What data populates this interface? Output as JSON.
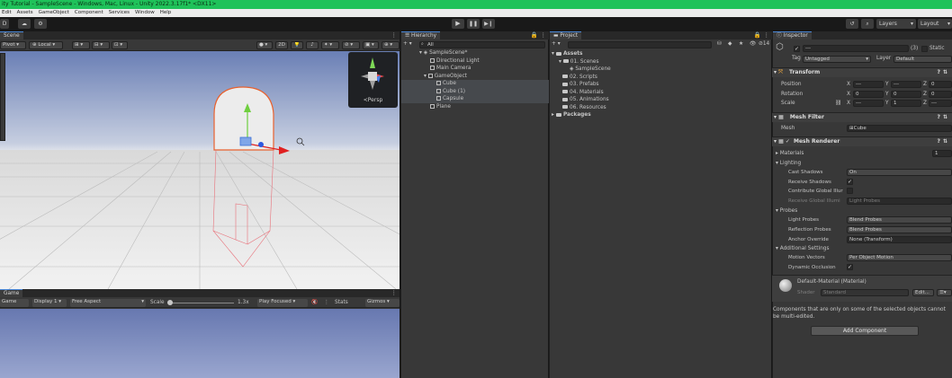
{
  "title_bar": {
    "text": "ity Tutorial - SampleScene - Windows, Mac, Linux - Unity 2022.3.17f1* <DX11>"
  },
  "menu": [
    "Edit",
    "Assets",
    "GameObject",
    "Component",
    "Services",
    "Window",
    "Help"
  ],
  "toolbar": {
    "left_label": "D",
    "layers_label": "Layers",
    "layout_label": "Layout"
  },
  "scene": {
    "tab_label": "Scene",
    "pivot_label": "Pivot",
    "local_label": "Local",
    "mode_2d": "2D",
    "gizmo_label": "<Persp"
  },
  "game": {
    "tab_label": "Game",
    "display_label": "Display 1",
    "aspect_label": "Free Aspect",
    "scale_label": "Scale",
    "scale_value": "1.3x",
    "play_focused_label": "Play Focused",
    "stats_label": "Stats",
    "gizmos_label": "Gizmos"
  },
  "hierarchy": {
    "tab_label": "Hierarchy",
    "search_placeholder": "All",
    "items": [
      {
        "label": "SampleScene*",
        "depth": 0
      },
      {
        "label": "Directional Light",
        "depth": 1
      },
      {
        "label": "Main Camera",
        "depth": 1
      },
      {
        "label": "GameObject",
        "depth": 1
      },
      {
        "label": "Cube",
        "depth": 2
      },
      {
        "label": "Cube (1)",
        "depth": 2
      },
      {
        "label": "Capsule",
        "depth": 2
      },
      {
        "label": "Plane",
        "depth": 1
      }
    ]
  },
  "project": {
    "tab_label": "Project",
    "item_count": "14",
    "items": [
      {
        "label": "Assets",
        "depth": 0,
        "bold": true
      },
      {
        "label": "01. Scenes",
        "depth": 1
      },
      {
        "label": "SampleScene",
        "depth": 2
      },
      {
        "label": "02. Scripts",
        "depth": 1
      },
      {
        "label": "03. Prefabs",
        "depth": 1
      },
      {
        "label": "04. Materials",
        "depth": 1
      },
      {
        "label": "05. Animations",
        "depth": 1
      },
      {
        "label": "06. Resources",
        "depth": 1
      },
      {
        "label": "Packages",
        "depth": 0,
        "bold": true
      }
    ]
  },
  "inspector": {
    "tab_label": "Inspector",
    "name_value": "---",
    "count_badge": "(3)",
    "static_label": "Static",
    "tag_label": "Tag",
    "tag_value": "Untagged",
    "layer_label": "Layer",
    "layer_value": "Default",
    "transform": {
      "title": "Transform",
      "rows": [
        {
          "label": "Position",
          "x": "---",
          "y": "---",
          "z": "0"
        },
        {
          "label": "Rotation",
          "x": "0",
          "y": "0",
          "z": "0"
        },
        {
          "label": "Scale",
          "x": "---",
          "y": "1",
          "z": "---"
        }
      ]
    },
    "mesh_filter": {
      "title": "Mesh Filter",
      "mesh_label": "Mesh",
      "mesh_value": "Cube"
    },
    "mesh_renderer": {
      "title": "Mesh Renderer",
      "materials_label": "Materials",
      "materials_count": "1",
      "lighting_label": "Lighting",
      "cast_shadows_label": "Cast Shadows",
      "cast_shadows_value": "On",
      "receive_shadows_label": "Receive Shadows",
      "contribute_gi_label": "Contribute Global Illur",
      "receive_gi_label": "Receive Global Illumi",
      "receive_gi_value": "Light Probes",
      "probes_label": "Probes",
      "light_probes_label": "Light Probes",
      "light_probes_value": "Blend Probes",
      "reflection_probes_label": "Reflection Probes",
      "reflection_probes_value": "Blend Probes",
      "anchor_override_label": "Anchor Override",
      "anchor_override_value": "None (Transform)",
      "additional_label": "Additional Settings",
      "motion_vectors_label": "Motion Vectors",
      "motion_vectors_value": "Per Object Motion",
      "dynamic_occlusion_label": "Dynamic Occlusion"
    },
    "material": {
      "name": "Default-Material (Material)",
      "shader_label": "Shader",
      "shader_value": "Standard",
      "edit_label": "Edit..."
    },
    "multi_edit_note": "Components that are only on some of the selected objects cannot be multi-edited.",
    "add_component_label": "Add Component"
  },
  "colors": {
    "accent_blue": "#4a88d9",
    "title_green": "#1fc25a",
    "panel_dark": "#383838",
    "selection_outline": "#e8612e"
  }
}
